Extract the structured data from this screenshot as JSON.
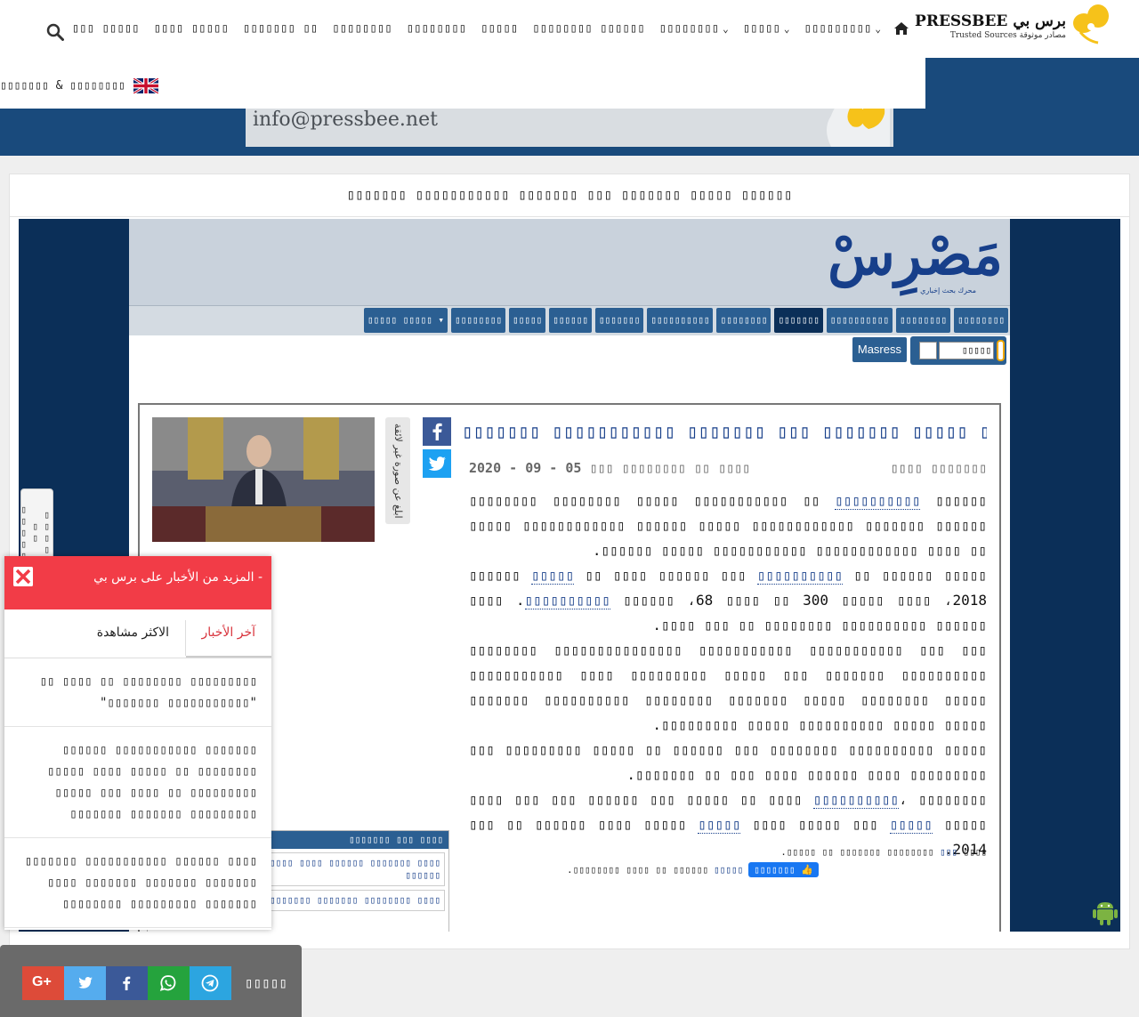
{
  "header": {
    "brand": "PRESSBEE برس بي",
    "tagline": "Trusted Sources مصادر موثوقة",
    "nav": [
      {
        "label": "▯▯▯▯▯▯▯▯▯",
        "has_dropdown": true
      },
      {
        "label": "▯▯▯▯▯",
        "has_dropdown": true
      },
      {
        "label": "▯▯▯▯▯▯▯▯",
        "has_dropdown": true
      },
      {
        "label": "▯▯▯▯▯▯▯▯ ▯▯▯▯▯▯",
        "has_dropdown": false
      },
      {
        "label": "▯▯▯▯▯",
        "has_dropdown": false
      },
      {
        "label": "▯▯▯▯▯▯▯▯",
        "has_dropdown": false
      },
      {
        "label": "▯▯▯▯▯▯▯▯",
        "has_dropdown": false
      },
      {
        "label": "▯▯▯▯▯▯▯ ▯▯",
        "has_dropdown": false
      },
      {
        "label": "▯▯▯▯ ▯▯▯▯▯",
        "has_dropdown": false
      },
      {
        "label": "▯▯▯ ▯▯▯▯▯",
        "has_dropdown": false
      }
    ],
    "sub_category": "▯▯▯▯▯▯▯ & ▯▯▯▯▯▯▯▯",
    "icons": {
      "home": "home-icon",
      "search": "search-icon",
      "flag": "uk-flag-icon"
    }
  },
  "banner": {
    "email": "info@pressbee.net"
  },
  "page": {
    "heading": "▯▯▯▯▯▯▯ ▯▯▯▯▯▯▯▯▯▯▯ ▯▯▯▯▯▯▯ ▯▯▯ ▯▯▯▯▯▯▯ ▯▯▯▯▯ ▯▯▯▯▯▯"
  },
  "masress": {
    "logo": "مَصْرِسْ",
    "logo_sub": "محرك بحث إخباري",
    "categories": [
      {
        "label": "▯▯▯▯▯▯▯▯",
        "active": false
      },
      {
        "label": "▯▯▯▯▯▯▯▯",
        "active": false
      },
      {
        "label": "▯▯▯▯▯▯▯▯▯▯",
        "active": false
      },
      {
        "label": "▯▯▯▯▯▯▯",
        "active": true
      },
      {
        "label": "▯▯▯▯▯▯▯▯",
        "active": false
      },
      {
        "label": "▯▯▯▯▯▯▯▯▯▯",
        "active": false
      },
      {
        "label": "▯▯▯▯▯▯▯",
        "active": false
      },
      {
        "label": "▯▯▯▯▯▯",
        "active": false
      },
      {
        "label": "▯▯▯▯▯",
        "active": false
      },
      {
        "label": "▯▯▯▯▯▯▯▯",
        "active": false
      },
      {
        "label": "▯▯▯▯▯ ▯▯▯▯▯ ▾",
        "active": false
      }
    ],
    "search_select_value": "▯▯▯▯▯",
    "masress_button": "Masress"
  },
  "article": {
    "title": "▯▯▯▯▯▯▯ ▯▯▯▯▯▯▯▯▯▯▯ ▯▯▯▯▯▯▯ ▯▯▯ ▯▯▯▯▯▯▯ ▯▯▯▯▯ ▯▯▯▯▯▯",
    "source": "▯▯▯▯ ▯▯▯▯▯▯▯",
    "date": "2020 - 09 - 05 ▯▯▯ ▯▯▯▯▯▯▯▯ ▯▯ ▯▯▯▯",
    "report_image": "ابلغ عن صورة غير لائقة",
    "paragraphs": {
      "p1a": "▯▯▯▯▯▯ ",
      "p1k": "▯▯▯▯▯▯▯▯▯▯",
      "p1b": " ▯▯ ▯▯▯▯▯▯▯▯▯▯▯ ▯▯▯▯▯ ▯▯▯▯▯▯▯▯ ▯▯▯▯▯▯▯▯ ▯▯▯▯▯▯ ▯▯▯▯▯▯▯ ▯▯▯▯▯▯▯▯▯▯▯▯ ▯▯▯▯▯ ▯▯▯▯▯▯ ▯▯▯▯▯▯▯▯▯▯▯▯ ▯▯▯▯▯ ▯▯ ▯▯▯▯ ▯▯▯▯▯▯▯▯▯▯▯▯ ▯▯▯▯▯▯▯▯▯▯▯ ▯▯▯▯▯ ▯▯▯▯▯▯.",
      "p2a": "▯▯▯▯▯ ▯▯▯▯▯▯ ▯▯ ",
      "p2k1": "▯▯▯▯▯▯▯▯▯▯",
      "p2b": " ▯▯▯ ▯▯▯▯▯▯ ▯▯▯▯ ▯▯ ",
      "p2k2": "▯▯▯▯▯",
      "p2c": " ▯▯▯▯▯▯ 2018، ▯▯▯▯ ▯▯▯▯▯ 300 ▯▯ ▯▯▯▯ 68، ▯▯▯▯▯▯ ",
      "p2k3": "▯▯▯▯▯▯▯▯▯▯",
      "p2d": ". ▯▯▯▯ ▯▯▯▯▯▯ ▯▯▯▯▯▯▯▯▯▯ ▯▯▯▯▯▯▯▯ ▯▯ ▯▯▯ ▯▯▯▯.",
      "p3": "▯▯▯ ▯▯▯ ▯▯▯▯▯▯▯▯▯▯▯ ▯▯▯▯▯▯▯▯▯▯▯ ▯▯▯▯▯▯▯▯▯▯▯▯▯▯▯ ▯▯▯▯▯▯▯▯ ▯▯▯▯▯▯▯▯▯▯ ▯▯▯▯▯▯▯ ▯▯▯ ▯▯▯▯▯ ▯▯▯▯▯▯▯▯▯ ▯▯▯▯ ▯▯▯▯▯▯▯▯▯▯▯ ▯▯▯▯▯ ▯▯▯▯▯▯▯▯ ▯▯▯▯▯ ▯▯▯▯▯▯▯ ▯▯▯▯▯▯▯▯ ▯▯▯▯▯▯▯▯▯▯ ▯▯▯▯▯▯▯ ▯▯▯▯▯ ▯▯▯▯▯ ▯▯▯▯▯▯▯▯▯▯ ▯▯▯▯▯ ▯▯▯▯▯▯▯▯▯.",
      "p4": "▯▯▯▯▯ ▯▯▯▯▯▯▯▯▯▯ ▯▯▯▯▯▯▯▯ ▯▯▯ ▯▯▯▯▯▯ ▯▯ ▯▯▯▯▯ ▯▯▯▯▯▯▯▯▯ ▯▯▯ ▯▯▯▯▯▯▯▯▯ ▯▯▯▯ ▯▯▯▯▯▯ ▯▯▯▯ ▯▯▯ ▯▯ ▯▯▯▯▯▯▯.",
      "p5a": "▯▯▯▯▯▯▯▯ ،",
      "p5k1": "▯▯▯▯▯▯▯▯▯▯",
      "p5b": " ▯▯▯▯ ▯▯ ▯▯▯▯▯ ▯▯▯ ▯▯▯▯▯▯ ▯▯▯ ▯▯▯ ▯▯▯▯ ▯▯▯▯▯ ",
      "p5k2": "▯▯▯▯▯",
      "p5c": " ▯▯▯ ▯▯▯▯▯ ▯▯▯▯ ",
      "p5k3": "▯▯▯▯▯",
      "p5d": " ▯▯▯▯▯ ▯▯▯▯ ▯▯▯▯▯▯ ▯▯ ▯▯▯ 2014."
    },
    "credit_a": "▯▯▯▯ ",
    "credit_link": "▯▯▯",
    "credit_b": " ▯▯▯▯▯▯▯▯ ▯▯▯▯▯▯▯ ▯▯ ▯▯▯▯▯.",
    "like_label": "▯▯▯▯▯▯▯",
    "like_link": "▯▯▯▯▯",
    "like_text": " ▯▯▯▯▯▯ ▯▯ ▯▯▯▯ ▯▯▯▯▯▯▯▯.",
    "related_heading": "▯▯▯▯▯▯▯ ▯▯▯ ▯▯▯▯",
    "related": [
      "▯▯▯▯▯▯ ▯▯▯▯ ▯▯▯▯▯▯▯ ▯▯▯▯ ▯▯▯▯▯▯ ▯▯▯▯▯▯▯ ▯▯▯▯ ▯▯▯▯▯▯",
      "▯▯▯▯ ▯▯▯▯ ▯▯▯▯▯▯▯ ▯▯▯▯▯▯▯ ▯▯▯▯▯▯▯ ▯▯▯▯▯▯▯▯ ▯▯▯▯"
    ]
  },
  "sidebar_tab": "▯▯▯▯ ▯▯ ▯▯▯▯▯",
  "more_news": {
    "title": "- المزيد من الأخبار على برس بي",
    "tab_latest": "آخر الأخبار",
    "tab_viewed": "الاكثر مشاهدة",
    "items": [
      "▯▯▯▯▯▯▯▯▯ ▯▯▯▯▯▯▯▯ ▯▯ ▯▯▯▯ ▯▯ \"▯▯▯▯▯▯▯▯▯▯▯ ▯▯▯▯▯▯▯\"",
      "▯▯▯▯▯▯▯ ▯▯▯▯▯▯▯▯▯▯▯ ▯▯▯▯▯▯ ▯▯▯▯▯▯▯▯ ▯▯ ▯▯▯▯▯ ▯▯▯▯ ▯▯▯▯▯ ▯▯▯▯▯▯▯▯▯ ▯▯ ▯▯▯▯ ▯▯▯ ▯▯▯▯▯ ▯▯▯▯▯▯▯▯▯ ▯▯▯▯▯▯▯ ▯▯▯▯▯▯▯",
      "▯▯▯▯ ▯▯▯▯▯▯ ▯▯▯▯▯▯▯▯▯▯▯ ▯▯▯▯▯▯▯ ▯▯▯▯▯▯▯ ▯▯▯▯▯▯▯ ▯▯▯▯▯▯▯ ▯▯▯▯ ▯▯▯▯▯▯▯ ▯▯▯▯▯▯▯▯▯ ▯▯▯▯▯▯▯▯"
    ]
  },
  "share": {
    "label": "▯▯▯▯▯"
  },
  "colors": {
    "brand_blue": "#194a7c",
    "accent_red": "#f23c47",
    "bee_yellow": "#f6c21a"
  }
}
